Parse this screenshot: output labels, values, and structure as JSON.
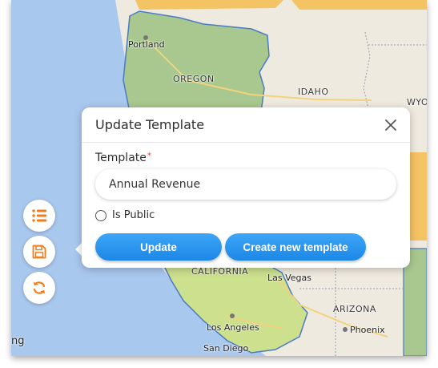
{
  "map": {
    "labels": {
      "portland": "Portland",
      "oregon": "OREGON",
      "idaho": "IDAHO",
      "wyoming": "WYO",
      "california": "CALIFORNIA",
      "las_vegas": "Las Vegas",
      "arizona": "ARIZONA",
      "phoenix": "Phoenix",
      "los_angeles": "Los Angeles",
      "san_diego": "San Diego",
      "attribution_fragment": "ng"
    },
    "colors": {
      "ocean": "#a9c8ee",
      "land": "#efeae0",
      "oregon_fill": "#a9c88f",
      "california_fill": "#cde08e",
      "orange_region": "#f4c363"
    }
  },
  "side_toolbar": {
    "icons": [
      "list-icon",
      "save-icon",
      "refresh-icon"
    ],
    "accent": "#f07c1e"
  },
  "popup": {
    "title": "Update Template",
    "template_label": "Template",
    "required_mark": "*",
    "template_value": "Annual Revenue",
    "is_public_label": "Is Public",
    "is_public_checked": false,
    "update_label": "Update",
    "create_label": "Create new template",
    "button_color": "#2196f3"
  }
}
